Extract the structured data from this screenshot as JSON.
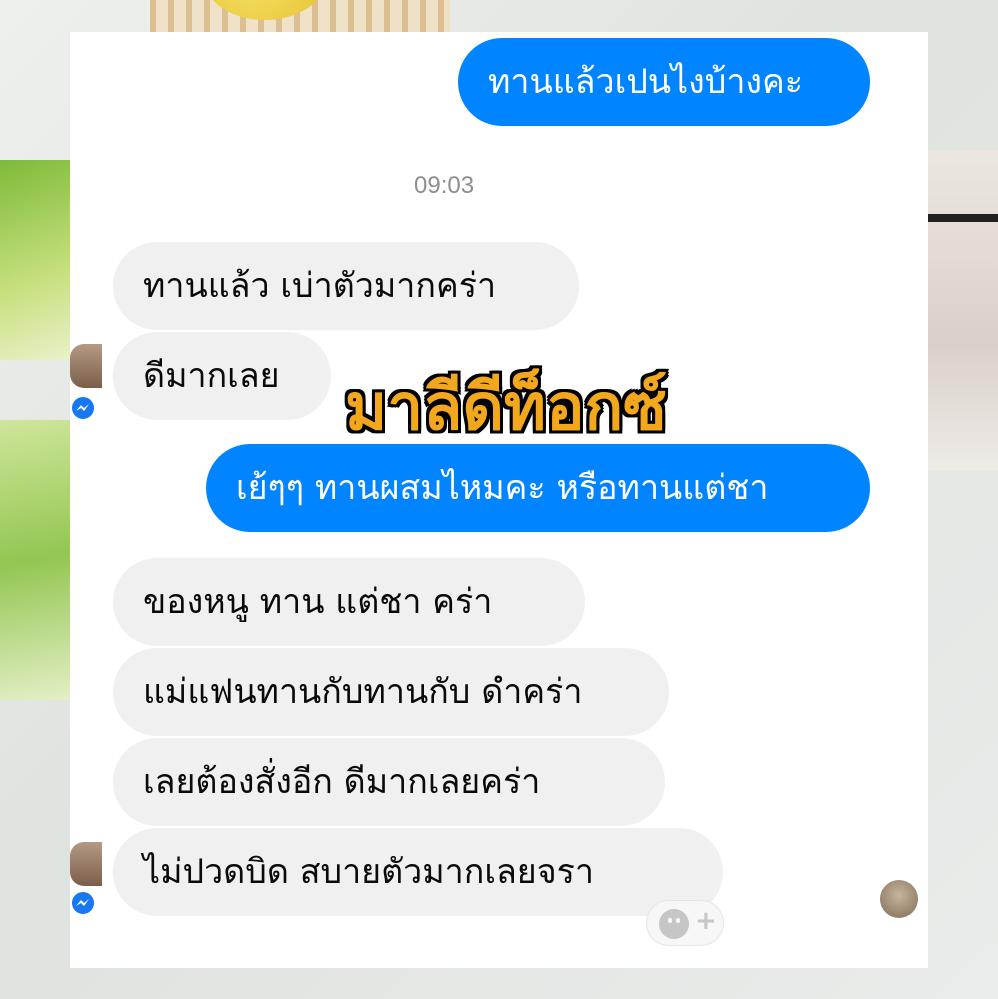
{
  "conversation": {
    "messages": [
      {
        "direction": "outgoing",
        "text": "ทานแล้วเปนไงบ้างคะ"
      },
      {
        "direction": "incoming",
        "text": "ทานแล้ว  เบ่าตัวมากคร่า"
      },
      {
        "direction": "incoming",
        "text": "ดีมากเลย"
      },
      {
        "direction": "outgoing",
        "text": "เย้ๆๆ ทานผสมไหมคะ หรือทานแต่ชา"
      },
      {
        "direction": "incoming",
        "text": "ของหนู  ทาน  แต่ชา  คร่า"
      },
      {
        "direction": "incoming",
        "text": "แม่แฟนทานกับทานกับ ดำคร่า"
      },
      {
        "direction": "incoming",
        "text": "เลยต้องสั่งอีก    ดีมากเลยคร่า"
      },
      {
        "direction": "incoming",
        "text": "ไม่ปวดบิด    สบายตัวมากเลยจรา"
      }
    ],
    "timestamp": "09:03"
  },
  "watermark": {
    "text": "มาลีดีท็อกซ์"
  },
  "colors": {
    "outgoing_bubble": "#0084ff",
    "incoming_bubble": "#f0f0f0",
    "watermark": "#f2a71c",
    "messenger_badge": "#1877f2"
  },
  "icons": {
    "messenger_badge": "messenger-icon",
    "reaction": "smiley-plus-icon"
  }
}
